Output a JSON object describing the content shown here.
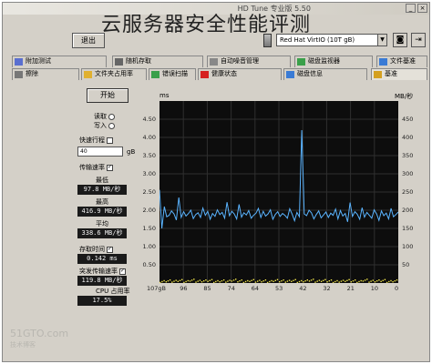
{
  "window": {
    "title": "HD Tune 专业版 5.50",
    "overlay_title": "云服务器安全性能评测"
  },
  "toolbar": {
    "drive": "Red Hat VirtIO (10T gB)",
    "exit_label": "退出"
  },
  "tabs_top": [
    {
      "label": "文件基准",
      "icon": "file-icon"
    },
    {
      "label": "磁盘监视器",
      "icon": "monitor-icon"
    },
    {
      "label": "自动噪音管理",
      "icon": "speaker-icon"
    },
    {
      "label": "随机存取",
      "icon": "dice-icon"
    },
    {
      "label": "附加测试",
      "icon": "extra-icon"
    }
  ],
  "tabs_bottom": [
    {
      "label": "基准",
      "icon": "benchmark-icon",
      "active": true
    },
    {
      "label": "磁盘信息",
      "icon": "disk-info-icon"
    },
    {
      "label": "健康状态",
      "icon": "health-icon"
    },
    {
      "label": "错误扫描",
      "icon": "scan-icon"
    },
    {
      "label": "文件夹占用率",
      "icon": "folder-icon"
    },
    {
      "label": "擦除",
      "icon": "erase-icon"
    }
  ],
  "controls": {
    "start_label": "开始",
    "read_label": "读取",
    "write_label": "写入",
    "short_stroke_label": "快速行程",
    "short_stroke_value": "40",
    "short_stroke_unit": "gB",
    "transfer_rate_label": "传输速率",
    "min_label": "最低",
    "min_value": "97.8 MB/秒",
    "max_label": "最高",
    "max_value": "416.9 MB/秒",
    "avg_label": "平均",
    "avg_value": "338.6 MB/秒",
    "access_time_label": "存取时间",
    "access_time_value": "0.142 ms",
    "burst_rate_label": "突发传输速率",
    "burst_rate_value": "119.8 MB/秒",
    "cpu_label": "CPU 占用率",
    "cpu_value": "17.5%"
  },
  "chart_data": {
    "type": "line",
    "left_axis_unit": "ms",
    "right_axis_unit": "MB/秒",
    "left_ticks": [
      "4.50",
      "4.00",
      "3.50",
      "3.00",
      "2.50",
      "2.00",
      "1.50",
      "1.00",
      "0.50"
    ],
    "right_ticks": [
      "450",
      "400",
      "350",
      "300",
      "250",
      "200",
      "150",
      "100",
      "50"
    ],
    "x_ticks": [
      "0",
      "10",
      "21",
      "32",
      "42",
      "53",
      "64",
      "74",
      "85",
      "96",
      "107gB"
    ],
    "x_range": [
      0,
      107
    ],
    "left_range": [
      0,
      5
    ],
    "right_range": [
      0,
      500
    ],
    "grid": true,
    "series": [
      {
        "color": "#5ab4ff",
        "values": [
          195,
          188,
          182,
          205,
          176,
          192,
          185,
          198,
          172,
          190,
          201,
          178,
          186,
          194,
          181,
          207,
          175,
          189,
          196,
          183,
          221,
          168,
          191,
          184,
          199,
          176,
          203,
          186,
          192,
          180,
          195,
          187,
          179,
          198,
          188,
          176,
          193,
          200,
          185,
          190,
          420,
          182,
          194,
          171,
          189,
          204,
          178,
          186,
          191,
          183,
          196,
          188,
          175,
          201,
          190,
          184,
          197,
          180,
          205,
          192,
          186,
          178,
          199,
          187,
          193,
          181,
          216,
          176,
          190,
          197,
          185,
          222,
          178,
          194,
          188,
          201,
          183,
          191,
          175,
          197,
          186,
          206,
          180,
          193,
          188,
          177,
          200,
          191,
          184,
          196,
          180,
          235,
          173,
          190,
          198,
          186,
          182,
          210,
          150,
          256
        ]
      },
      {
        "color": "#f0e44a",
        "values": [
          0.03,
          0.05,
          0.04,
          0.06,
          0.03,
          0.07,
          0.04,
          0.05,
          0.06,
          0.03,
          0.05,
          0.04,
          0.07,
          0.05,
          0.03,
          0.06,
          0.04,
          0.05,
          0.03,
          0.06,
          0.05,
          0.04,
          0.06,
          0.03,
          0.05,
          0.07,
          0.04,
          0.06,
          0.05,
          0.03,
          0.04,
          0.06,
          0.05,
          0.03,
          0.07,
          0.04,
          0.05,
          0.06,
          0.03,
          0.05
        ]
      }
    ]
  },
  "watermark": {
    "line1": "51GTO.com",
    "line2": "技术博客"
  }
}
